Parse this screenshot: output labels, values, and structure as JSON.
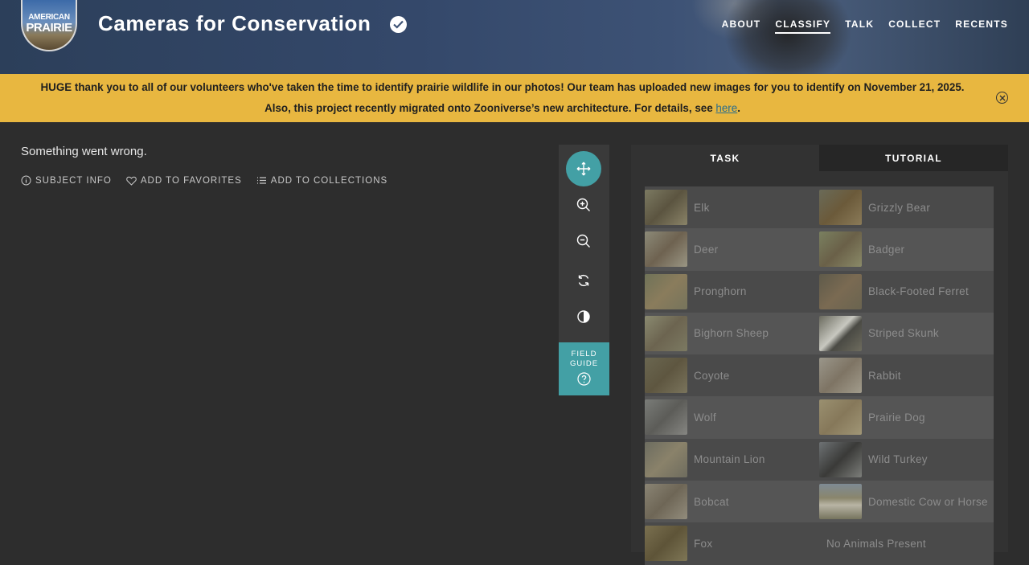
{
  "header": {
    "logo_line1": "AMERICAN",
    "logo_line2": "PRAIRIE",
    "project_title": "Cameras for Conservation",
    "nav": [
      "ABOUT",
      "CLASSIFY",
      "TALK",
      "COLLECT",
      "RECENTS"
    ],
    "active_nav": "CLASSIFY"
  },
  "banner": {
    "line1": "HUGE thank you to all of our volunteers who've taken the time to identify prairie wildlife in our photos! Our team has uploaded new images for you to identify on November 21, 2025.",
    "line2_prefix": "Also, this project recently migrated onto Zooniverse’s new architecture. For details, see ",
    "line2_link": "here",
    "line2_suffix": "."
  },
  "subject": {
    "error_text": "Something went wrong.",
    "subject_info": "SUBJECT INFO",
    "add_favorites": "ADD TO FAVORITES",
    "add_collections": "ADD TO COLLECTIONS"
  },
  "toolbar": {
    "field_guide_line1": "FIELD",
    "field_guide_line2": "GUIDE"
  },
  "task_panel": {
    "tab_task": "TASK",
    "tab_tutorial": "TUTORIAL",
    "choices": [
      [
        "Elk",
        "Grizzly Bear"
      ],
      [
        "Deer",
        "Badger"
      ],
      [
        "Pronghorn",
        "Black-Footed Ferret"
      ],
      [
        "Bighorn Sheep",
        "Striped Skunk"
      ],
      [
        "Coyote",
        "Rabbit"
      ],
      [
        "Wolf",
        "Prairie Dog"
      ],
      [
        "Mountain Lion",
        "Wild Turkey"
      ],
      [
        "Bobcat",
        "Domestic Cow or Horse"
      ],
      [
        "Fox",
        "No Animals Present"
      ]
    ]
  },
  "colors": {
    "banner_bg": "#e8b740",
    "accent_teal": "#43a0a5",
    "page_bg": "#2d2d2d"
  }
}
